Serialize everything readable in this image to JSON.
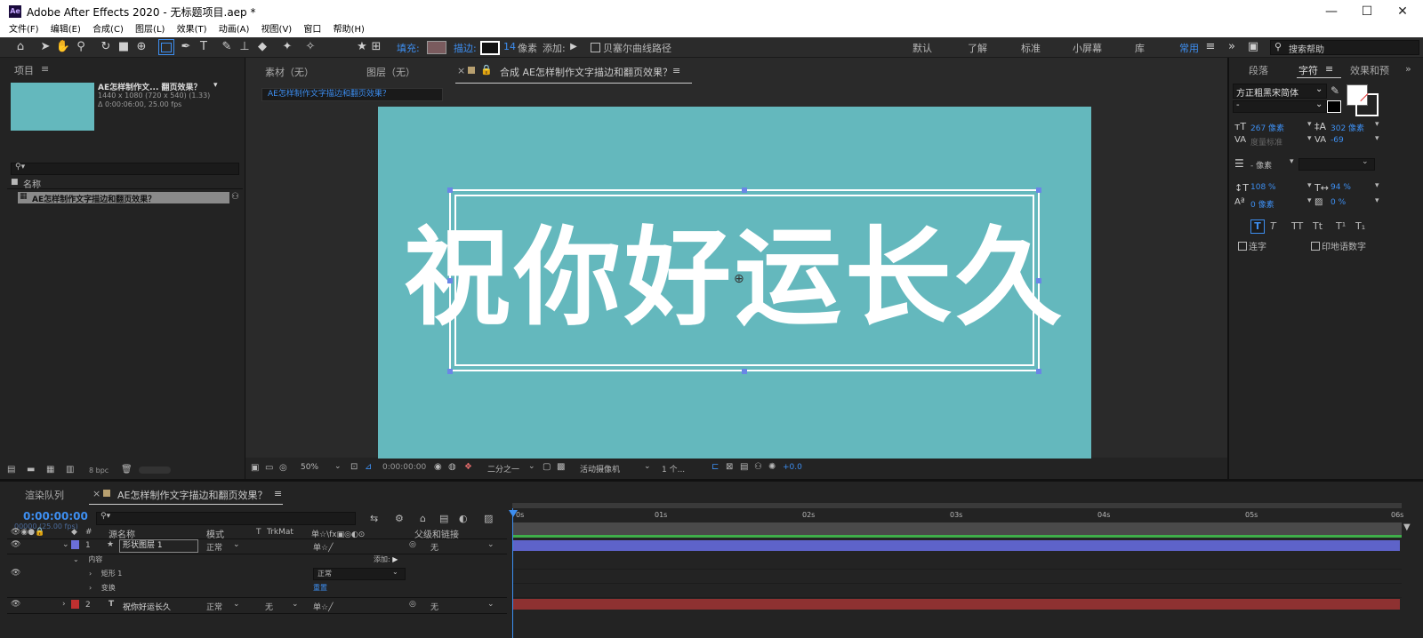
{
  "window": {
    "title": "Adobe After Effects 2020 - 无标题项目.aep *",
    "logo": "Ae",
    "controls": [
      "—",
      "☐",
      "✕"
    ]
  },
  "menu": [
    "文件(F)",
    "编辑(E)",
    "合成(C)",
    "图层(L)",
    "效果(T)",
    "动画(A)",
    "视图(V)",
    "窗口",
    "帮助(H)"
  ],
  "toolbar": {
    "fill_label": "填充:",
    "stroke_label": "描边:",
    "stroke_size": "14",
    "stroke_unit": "像素",
    "add_label": "添加:",
    "bezier_label": "贝塞尔曲线路径",
    "workspaces": [
      "默认",
      "了解",
      "标准",
      "小屏幕",
      "库",
      "常用"
    ],
    "search_placeholder": "搜索帮助"
  },
  "project_panel": {
    "title": "项目",
    "item_name": "AE怎样制作文... 翻页效果？",
    "item_info1": "1440 x 1080 (720 x 540) (1.33)",
    "item_info2": "Δ 0:00:06:00, 25.00 fps",
    "column_name": "名称",
    "list_item": "AE怎样制作文字描边和翻页效果？",
    "bpc": "8 bpc",
    "thumb_color": "#64b8bd"
  },
  "viewer_tabs": {
    "footage": "素材（无）",
    "layer": "图层（无）",
    "comp": "合成 AE怎样制作文字描边和翻页效果？",
    "breadcrumb": "AE怎样制作文字描边和翻页效果？"
  },
  "composition": {
    "text": "祝你好运长久",
    "bg_color": "#64b8bd"
  },
  "viewer_controls": {
    "zoom": "50%",
    "timecode": "0:00:00:00",
    "resolution": "二分之一",
    "camera": "活动摄像机",
    "views": "1 个...",
    "exposure": "+0.0"
  },
  "character_panel": {
    "tabs": [
      "段落",
      "字符",
      "效果和预"
    ],
    "font": "方正粗黑宋简体",
    "style": "-",
    "font_size": "267 像素",
    "leading": "302 像素",
    "kerning": "度量标准",
    "tracking": "-69",
    "stroke_width": "- 像素",
    "vscale": "108 %",
    "hscale": "94 %",
    "baseline": "0 像素",
    "tsume": "0 %",
    "styles": [
      "T",
      "T",
      "TT",
      "Tt",
      "T¹",
      "T₁"
    ],
    "ligatures": "连字",
    "hindi": "印地语数字"
  },
  "timeline": {
    "render_tab": "渲染队列",
    "comp_tab": "AE怎样制作文字描边和翻页效果？",
    "timecode": "0:00:00:00",
    "fps": "00000 (25.00 fps)",
    "headers": {
      "num": "#",
      "name": "源名称",
      "mode": "模式",
      "t": "T",
      "trkmat": "TrkMat",
      "parent": "父级和链接"
    },
    "ticks": [
      "0s",
      "01s",
      "02s",
      "03s",
      "04s",
      "05s",
      "06s"
    ],
    "layers": [
      {
        "num": "1",
        "name": "形状图层 1",
        "mode": "正常",
        "parent": "无",
        "color": "#6b6fd9"
      },
      {
        "num": "2",
        "name": "祝你好运长久",
        "mode": "正常",
        "trkmat": "无",
        "parent": "无",
        "color": "#c03030"
      }
    ],
    "sub_rows": {
      "contents": "内容",
      "add": "添加:",
      "rect": "矩形 1",
      "rect_mode": "正常",
      "transform": "变换",
      "reset": "重置"
    }
  }
}
